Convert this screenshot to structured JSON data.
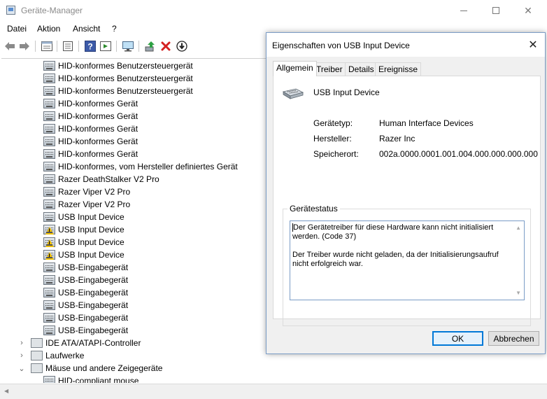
{
  "window": {
    "title": "Geräte-Manager"
  },
  "menu": [
    "Datei",
    "Aktion",
    "Ansicht",
    "?"
  ],
  "toolbar": {
    "icons": [
      "back-icon",
      "forward-icon",
      "properties-grid-icon",
      "driver-details-icon",
      "help-icon",
      "show-hidden-icon",
      "scan-hardware-icon",
      "update-driver-icon",
      "uninstall-icon",
      "disable-device-icon"
    ],
    "accent": "#0078d7"
  },
  "tree": {
    "hid_children": [
      {
        "label": "HID-konformes Benutzersteuergerät",
        "warning": false
      },
      {
        "label": "HID-konformes Benutzersteuergerät",
        "warning": false
      },
      {
        "label": "HID-konformes Benutzersteuergerät",
        "warning": false
      },
      {
        "label": "HID-konformes Gerät",
        "warning": false
      },
      {
        "label": "HID-konformes Gerät",
        "warning": false
      },
      {
        "label": "HID-konformes Gerät",
        "warning": false
      },
      {
        "label": "HID-konformes Gerät",
        "warning": false
      },
      {
        "label": "HID-konformes Gerät",
        "warning": false
      },
      {
        "label": "HID-konformes, vom Hersteller definiertes Gerät",
        "warning": false
      },
      {
        "label": "Razer DeathStalker V2 Pro",
        "warning": false
      },
      {
        "label": "Razer Viper V2 Pro",
        "warning": false
      },
      {
        "label": "Razer Viper V2 Pro",
        "warning": false
      },
      {
        "label": "USB Input Device",
        "warning": false
      },
      {
        "label": "USB Input Device",
        "warning": true
      },
      {
        "label": "USB Input Device",
        "warning": true
      },
      {
        "label": "USB Input Device",
        "warning": true
      },
      {
        "label": "USB-Eingabegerät",
        "warning": false
      },
      {
        "label": "USB-Eingabegerät",
        "warning": false
      },
      {
        "label": "USB-Eingabegerät",
        "warning": false
      },
      {
        "label": "USB-Eingabegerät",
        "warning": false
      },
      {
        "label": "USB-Eingabegerät",
        "warning": false
      },
      {
        "label": "USB-Eingabegerät",
        "warning": false
      }
    ],
    "categories": [
      {
        "label": "IDE ATA/ATAPI-Controller",
        "expanded": false,
        "icon": "ide-controller-icon"
      },
      {
        "label": "Laufwerke",
        "expanded": false,
        "icon": "disk-drive-icon"
      },
      {
        "label": "Mäuse und andere Zeigegeräte",
        "expanded": true,
        "icon": "mouse-icon"
      }
    ],
    "mouse_children": [
      {
        "label": "HID-compliant mouse"
      }
    ]
  },
  "dialog": {
    "title": "Eigenschaften von USB Input Device",
    "tabs": [
      "Allgemein",
      "Treiber",
      "Details",
      "Ereignisse"
    ],
    "active_tab": "Allgemein",
    "device_name": "USB Input Device",
    "props": [
      {
        "label": "Gerätetyp:",
        "value": "Human Interface Devices"
      },
      {
        "label": "Hersteller:",
        "value": "Razer Inc"
      },
      {
        "label": "Speicherort:",
        "value": "002a.0000.0001.001.004.000.000.000.000"
      }
    ],
    "status_title": "Gerätestatus",
    "status_lines": [
      "Der Gerätetreiber für diese Hardware kann nicht initialisiert werden. (Code 37)",
      "Der Treiber wurde nicht geladen, da der Initialisierungsaufruf nicht erfolgreich war."
    ],
    "ok_label": "OK",
    "cancel_label": "Abbrechen"
  }
}
